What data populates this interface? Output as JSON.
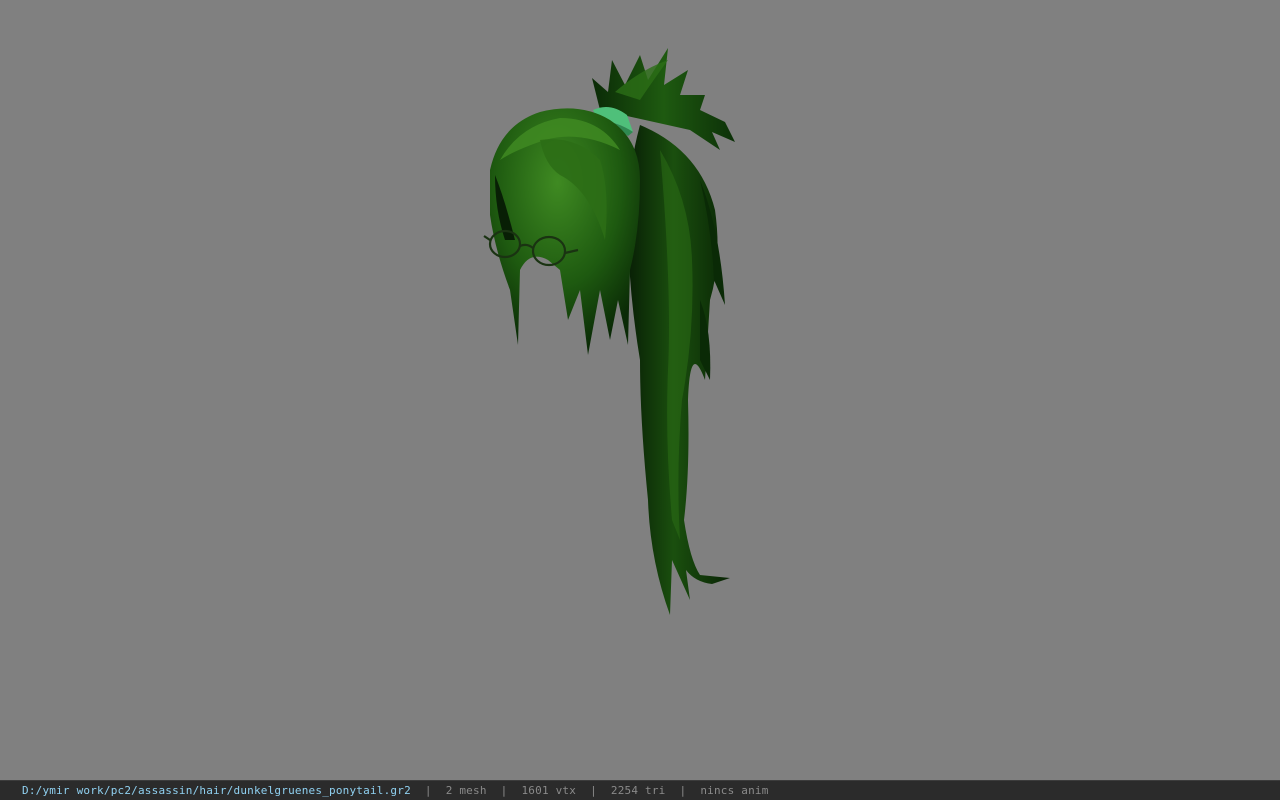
{
  "viewport": {
    "background_color": "#808080",
    "model": {
      "name": "dunkelgruenes_ponytail",
      "hair_color_dark": "#0a2a06",
      "hair_color_mid": "#1e5a10",
      "hair_color_light": "#3f8a22",
      "band_color": "#4fc07a",
      "glasses_color": "#1a3312"
    }
  },
  "status_bar": {
    "file_path": "D:/ymir work/pc2/assassin/hair/dunkelgruenes_ponytail.gr2",
    "separator": "|",
    "mesh_count": "2 mesh",
    "vertex_count": "1601 vtx",
    "triangle_count": "2254 tri",
    "anim_status": "nincs anim",
    "path_color": "#8fd0f0",
    "text_color": "#8a8a8a"
  }
}
